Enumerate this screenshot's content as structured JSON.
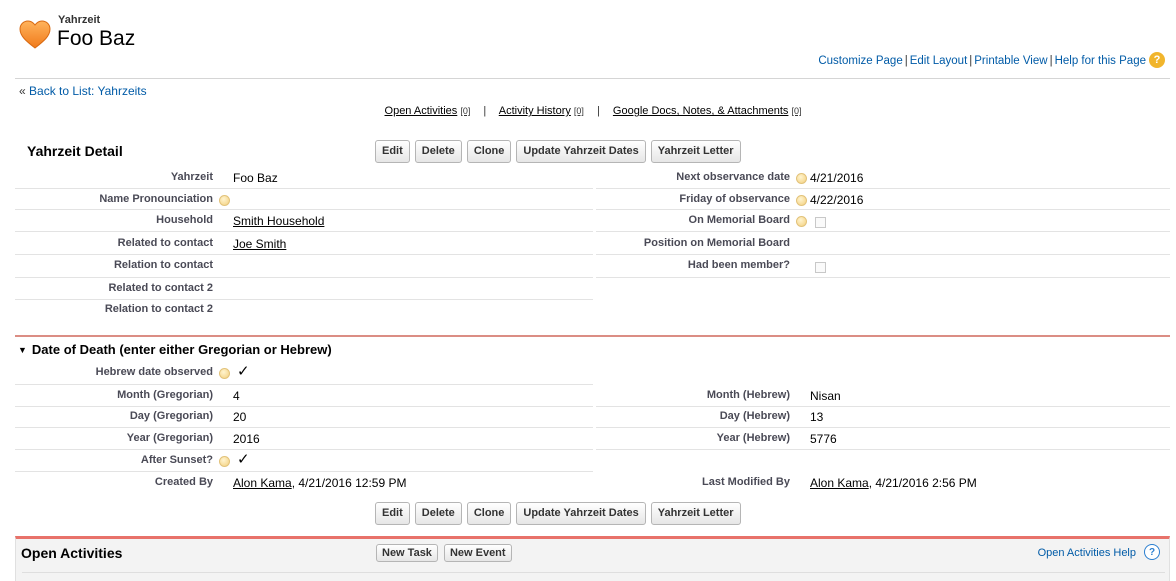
{
  "header": {
    "object_type": "Yahrzeit",
    "record_name": "Foo Baz",
    "links": [
      "Customize Page",
      "Edit Layout",
      "Printable View",
      "Help for this Page"
    ],
    "help_icon": "?"
  },
  "back_link": {
    "prefix": "«",
    "label": "Back to List: Yahrzeits"
  },
  "related_links": [
    {
      "label": "Open Activities",
      "count": "[0]"
    },
    {
      "label": "Activity History",
      "count": "[0]"
    },
    {
      "label": "Google Docs, Notes, & Attachments",
      "count": "[0]"
    }
  ],
  "detail": {
    "title": "Yahrzeit Detail",
    "buttons": [
      "Edit",
      "Delete",
      "Clone",
      "Update Yahrzeit Dates",
      "Yahrzeit Letter"
    ],
    "left_fields": [
      {
        "label": "Yahrzeit",
        "value": "Foo Baz",
        "link": false,
        "info": false
      },
      {
        "label": "Name Pronounciation",
        "value": "",
        "link": false,
        "info": true
      },
      {
        "label": "Household",
        "value": "Smith Household",
        "link": true,
        "info": false
      },
      {
        "label": "Related to contact",
        "value": "Joe Smith",
        "link": true,
        "info": false
      },
      {
        "label": "Relation to contact",
        "value": "",
        "link": false,
        "info": false
      },
      {
        "label": "Related to contact 2",
        "value": "",
        "link": false,
        "info": false
      },
      {
        "label": "Relation to contact 2",
        "value": "",
        "link": false,
        "info": false
      }
    ],
    "right_fields": [
      {
        "label": "Next observance date",
        "value": "4/21/2016",
        "info": true
      },
      {
        "label": "Friday of observance",
        "value": "4/22/2016",
        "info": true
      },
      {
        "label": "On Memorial Board",
        "value": "",
        "info": true,
        "checkbox": "unchecked"
      },
      {
        "label": "Position on Memorial Board",
        "value": "",
        "info": false
      },
      {
        "label": "Had been member?",
        "value": "",
        "info": false,
        "checkbox": "unchecked"
      }
    ]
  },
  "death_section": {
    "title": "Date of Death (enter either Gregorian or Hebrew)",
    "toggle_icon": "▼",
    "hebrew_observed": {
      "label": "Hebrew date observed",
      "checked": "✓"
    },
    "left_fields": [
      {
        "label": "Month (Gregorian)",
        "value": "4"
      },
      {
        "label": "Day (Gregorian)",
        "value": "20"
      },
      {
        "label": "Year (Gregorian)",
        "value": "2016"
      }
    ],
    "right_fields": [
      {
        "label": "Month (Hebrew)",
        "value": "Nisan"
      },
      {
        "label": "Day (Hebrew)",
        "value": "13"
      },
      {
        "label": "Year (Hebrew)",
        "value": "5776"
      }
    ],
    "after_sunset": {
      "label": "After Sunset?",
      "checked": "✓"
    },
    "created_by": {
      "label": "Created By",
      "user": "Alon Kama",
      "date": ", 4/21/2016 12:59 PM"
    },
    "last_modified_by": {
      "label": "Last Modified By",
      "user": "Alon Kama",
      "date": ", 4/21/2016 2:56 PM"
    }
  },
  "bottom_buttons": [
    "Edit",
    "Delete",
    "Clone",
    "Update Yahrzeit Dates",
    "Yahrzeit Letter"
  ],
  "open_activities": {
    "title": "Open Activities",
    "buttons": [
      "New Task",
      "New Event"
    ],
    "help_link": "Open Activities Help",
    "help_icon": "?"
  },
  "colors": {
    "link": "#015ba7",
    "section_rule": "#db8d84",
    "open_activities_accent": "#e8726a",
    "help_icon": "#f1b52c"
  }
}
